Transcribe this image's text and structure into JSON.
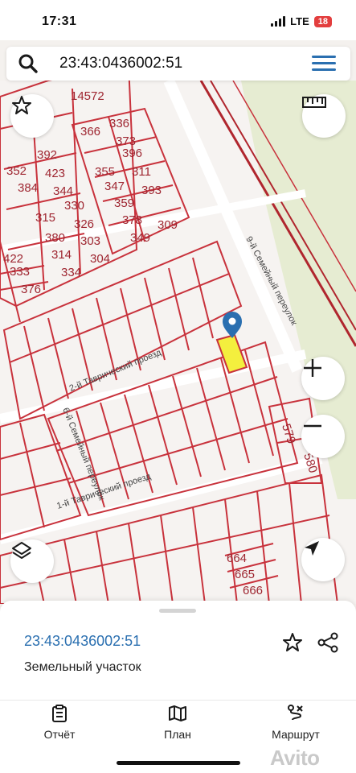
{
  "status_bar": {
    "time": "17:31",
    "network": "LTE",
    "battery": "18"
  },
  "search": {
    "query": "23:43:0436002:51"
  },
  "map": {
    "block_label": "14572",
    "street_labels": [
      "9-й Семейный переулок",
      "2-й Таврический проезд",
      "6-й Семейный переулок",
      "1-й Таврический проезд"
    ],
    "parcel_numbers": [
      "366",
      "336",
      "352",
      "392",
      "373",
      "384",
      "423",
      "355",
      "396",
      "344",
      "347",
      "311",
      "359",
      "393",
      "315",
      "330",
      "380",
      "326",
      "378",
      "314",
      "303",
      "349",
      "309",
      "422",
      "334",
      "304",
      "333",
      "376",
      "579",
      "580",
      "664",
      "665",
      "666"
    ],
    "colors": {
      "boundary": "#c8323c",
      "selected_fill": "#f4ef3e",
      "background": "#f6f3f1",
      "green_area": "#e6ecd2",
      "marker": "#2a6fb0"
    }
  },
  "sheet": {
    "parcel_number": "23:43:0436002:51",
    "parcel_type": "Земельный участок",
    "nav": [
      {
        "label": "Отчёт",
        "icon": "clipboard-icon"
      },
      {
        "label": "План",
        "icon": "map-icon"
      },
      {
        "label": "Маршрут",
        "icon": "route-icon"
      }
    ],
    "watermark": "Avito"
  }
}
